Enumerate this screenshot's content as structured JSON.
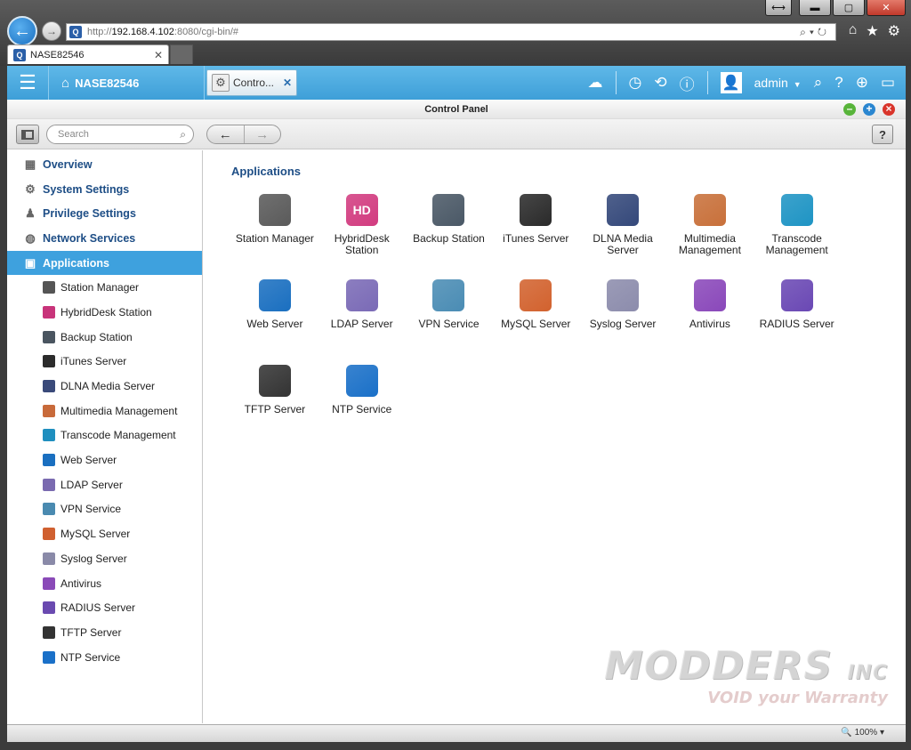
{
  "browser": {
    "url_prefix": "http://",
    "url_host": "192.168.4.102",
    "url_rest": ":8080/cgi-bin/#",
    "site_icon": "Q",
    "tab_title": "NASE82546",
    "zoom": "100%"
  },
  "header": {
    "host": "NASE82546",
    "app_tab": "Contro...",
    "user": "admin"
  },
  "window": {
    "title": "Control Panel"
  },
  "toolbar": {
    "search_placeholder": "Search",
    "help": "?"
  },
  "sidebar": {
    "sections": [
      {
        "label": "Overview",
        "icon": "grid-icon"
      },
      {
        "label": "System Settings",
        "icon": "gear-icon"
      },
      {
        "label": "Privilege Settings",
        "icon": "user-icon"
      },
      {
        "label": "Network Services",
        "icon": "globe-icon"
      },
      {
        "label": "Applications",
        "icon": "drive-icon"
      }
    ],
    "sub_items": [
      {
        "label": "Station Manager",
        "color": "#555555"
      },
      {
        "label": "HybridDesk Station",
        "color": "#c8347a"
      },
      {
        "label": "Backup Station",
        "color": "#4a5560"
      },
      {
        "label": "iTunes Server",
        "color": "#2c2c2c"
      },
      {
        "label": "DLNA Media Server",
        "color": "#3a4a7a"
      },
      {
        "label": "Multimedia Management",
        "color": "#c86a3a"
      },
      {
        "label": "Transcode Management",
        "color": "#1f8fbf"
      },
      {
        "label": "Web Server",
        "color": "#1a6fc0"
      },
      {
        "label": "LDAP Server",
        "color": "#7a6ab0"
      },
      {
        "label": "VPN Service",
        "color": "#4a8ab0"
      },
      {
        "label": "MySQL Server",
        "color": "#d06030"
      },
      {
        "label": "Syslog Server",
        "color": "#8a8aa8"
      },
      {
        "label": "Antivirus",
        "color": "#8a4ab8"
      },
      {
        "label": "RADIUS Server",
        "color": "#6a4ab0"
      },
      {
        "label": "TFTP Server",
        "color": "#333333"
      },
      {
        "label": "NTP Service",
        "color": "#1a70c8"
      }
    ]
  },
  "content": {
    "title": "Applications",
    "apps": [
      {
        "label": "Station Manager",
        "color": "#5a5a5a",
        "glyph": ""
      },
      {
        "label": "HybridDesk Station",
        "color": "#d23c80",
        "glyph": "HD"
      },
      {
        "label": "Backup Station",
        "color": "#4a5866",
        "glyph": ""
      },
      {
        "label": "iTunes Server",
        "color": "#2a2a2a",
        "glyph": ""
      },
      {
        "label": "DLNA Media Server",
        "color": "#34487a",
        "glyph": ""
      },
      {
        "label": "Multimedia Management",
        "color": "#c8703a",
        "glyph": ""
      },
      {
        "label": "Transcode Management",
        "color": "#1e94c4",
        "glyph": ""
      },
      {
        "label": "Web Server",
        "color": "#1a6fc0",
        "glyph": ""
      },
      {
        "label": "LDAP Server",
        "color": "#7a6ab6",
        "glyph": ""
      },
      {
        "label": "VPN Service",
        "color": "#4a8cb4",
        "glyph": ""
      },
      {
        "label": "MySQL Server",
        "color": "#d2622e",
        "glyph": ""
      },
      {
        "label": "Syslog Server",
        "color": "#8c8cac",
        "glyph": ""
      },
      {
        "label": "Antivirus",
        "color": "#8a48ba",
        "glyph": ""
      },
      {
        "label": "RADIUS Server",
        "color": "#6a48b4",
        "glyph": ""
      },
      {
        "label": "TFTP Server",
        "color": "#333333",
        "glyph": ""
      },
      {
        "label": "NTP Service",
        "color": "#1a70c8",
        "glyph": ""
      }
    ]
  },
  "watermark": {
    "line1": "MODDERS",
    "line2": "INC",
    "line3": "VOID your Warranty"
  }
}
